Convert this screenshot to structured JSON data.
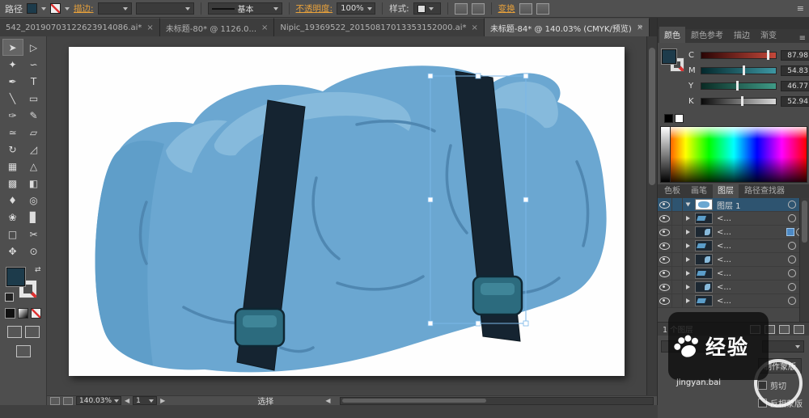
{
  "icons": {
    "close": "×",
    "overflow": "»",
    "menu": "≡",
    "swap": "⇄"
  },
  "controlbar": {
    "mode_label": "路径",
    "stroke_label": "描边:",
    "brush_name": "基本",
    "opacity_label": "不透明度:",
    "opacity_value": "100%",
    "style_label": "样式:",
    "transform_label": "变换"
  },
  "tabs": [
    {
      "label": "542_20190703122623914086.ai*"
    },
    {
      "label": "未标题-80* @ 1126.0..."
    },
    {
      "label": "Nipic_19369522_20150817013353152000.ai*"
    },
    {
      "label": "未标题-84* @ 140.03% (CMYK/预览)"
    }
  ],
  "toolbar": {
    "tools": [
      {
        "name": "selection",
        "glyph": "➤"
      },
      {
        "name": "direct-selection",
        "glyph": "▷"
      },
      {
        "name": "magic-wand",
        "glyph": "✦"
      },
      {
        "name": "lasso",
        "glyph": "∽"
      },
      {
        "name": "pen",
        "glyph": "✒"
      },
      {
        "name": "type",
        "glyph": "T"
      },
      {
        "name": "line-segment",
        "glyph": "╲"
      },
      {
        "name": "rectangle",
        "glyph": "▭"
      },
      {
        "name": "paintbrush",
        "glyph": "✑"
      },
      {
        "name": "pencil",
        "glyph": "✎"
      },
      {
        "name": "width",
        "glyph": "≃"
      },
      {
        "name": "eraser",
        "glyph": "▱"
      },
      {
        "name": "rotate",
        "glyph": "↻"
      },
      {
        "name": "scale",
        "glyph": "◿"
      },
      {
        "name": "shape-builder",
        "glyph": "▦"
      },
      {
        "name": "perspective-grid",
        "glyph": "△"
      },
      {
        "name": "mesh",
        "glyph": "▩"
      },
      {
        "name": "gradient",
        "glyph": "◧"
      },
      {
        "name": "eyedropper",
        "glyph": "♦"
      },
      {
        "name": "blend",
        "glyph": "◎"
      },
      {
        "name": "symbol-sprayer",
        "glyph": "❀"
      },
      {
        "name": "graph",
        "glyph": "▊"
      },
      {
        "name": "artboard",
        "glyph": "□"
      },
      {
        "name": "slice",
        "glyph": "✂"
      },
      {
        "name": "hand",
        "glyph": "✥"
      },
      {
        "name": "zoom",
        "glyph": "⊙"
      }
    ]
  },
  "panels": {
    "color": {
      "tabs": [
        "颜色",
        "颜色参考",
        "描边",
        "渐变"
      ],
      "channels": [
        {
          "label": "C",
          "value": "87.98"
        },
        {
          "label": "M",
          "value": "54.83"
        },
        {
          "label": "Y",
          "value": "46.77"
        },
        {
          "label": "K",
          "value": "52.94"
        }
      ]
    },
    "dock_tabs": [
      "色板",
      "画笔",
      "图层",
      "路径查找器"
    ],
    "layers": {
      "rows": [
        {
          "label": "图层 1"
        },
        {
          "label": "<..."
        },
        {
          "label": "<..."
        },
        {
          "label": "<..."
        },
        {
          "label": "<..."
        },
        {
          "label": "<..."
        },
        {
          "label": "<..."
        },
        {
          "label": "<..."
        }
      ],
      "footer": "1 个图层"
    },
    "transparency": {
      "make_mask": "制作蒙版",
      "clip": "剪切",
      "invert": "反相蒙版"
    }
  },
  "statusbar": {
    "zoom": "140.03%",
    "page": "1",
    "tool": "选择"
  },
  "watermark": {
    "brand": "经验",
    "url": "jingyan.bai"
  },
  "artwork_colors": {
    "bag_blue": "#6BA7D1",
    "bag_highlight": "#86BADC",
    "bag_shade_line": "#4F87B1",
    "strap": "#152431",
    "buckle": "#2C6B7E",
    "selection": "#7AB7E8"
  }
}
